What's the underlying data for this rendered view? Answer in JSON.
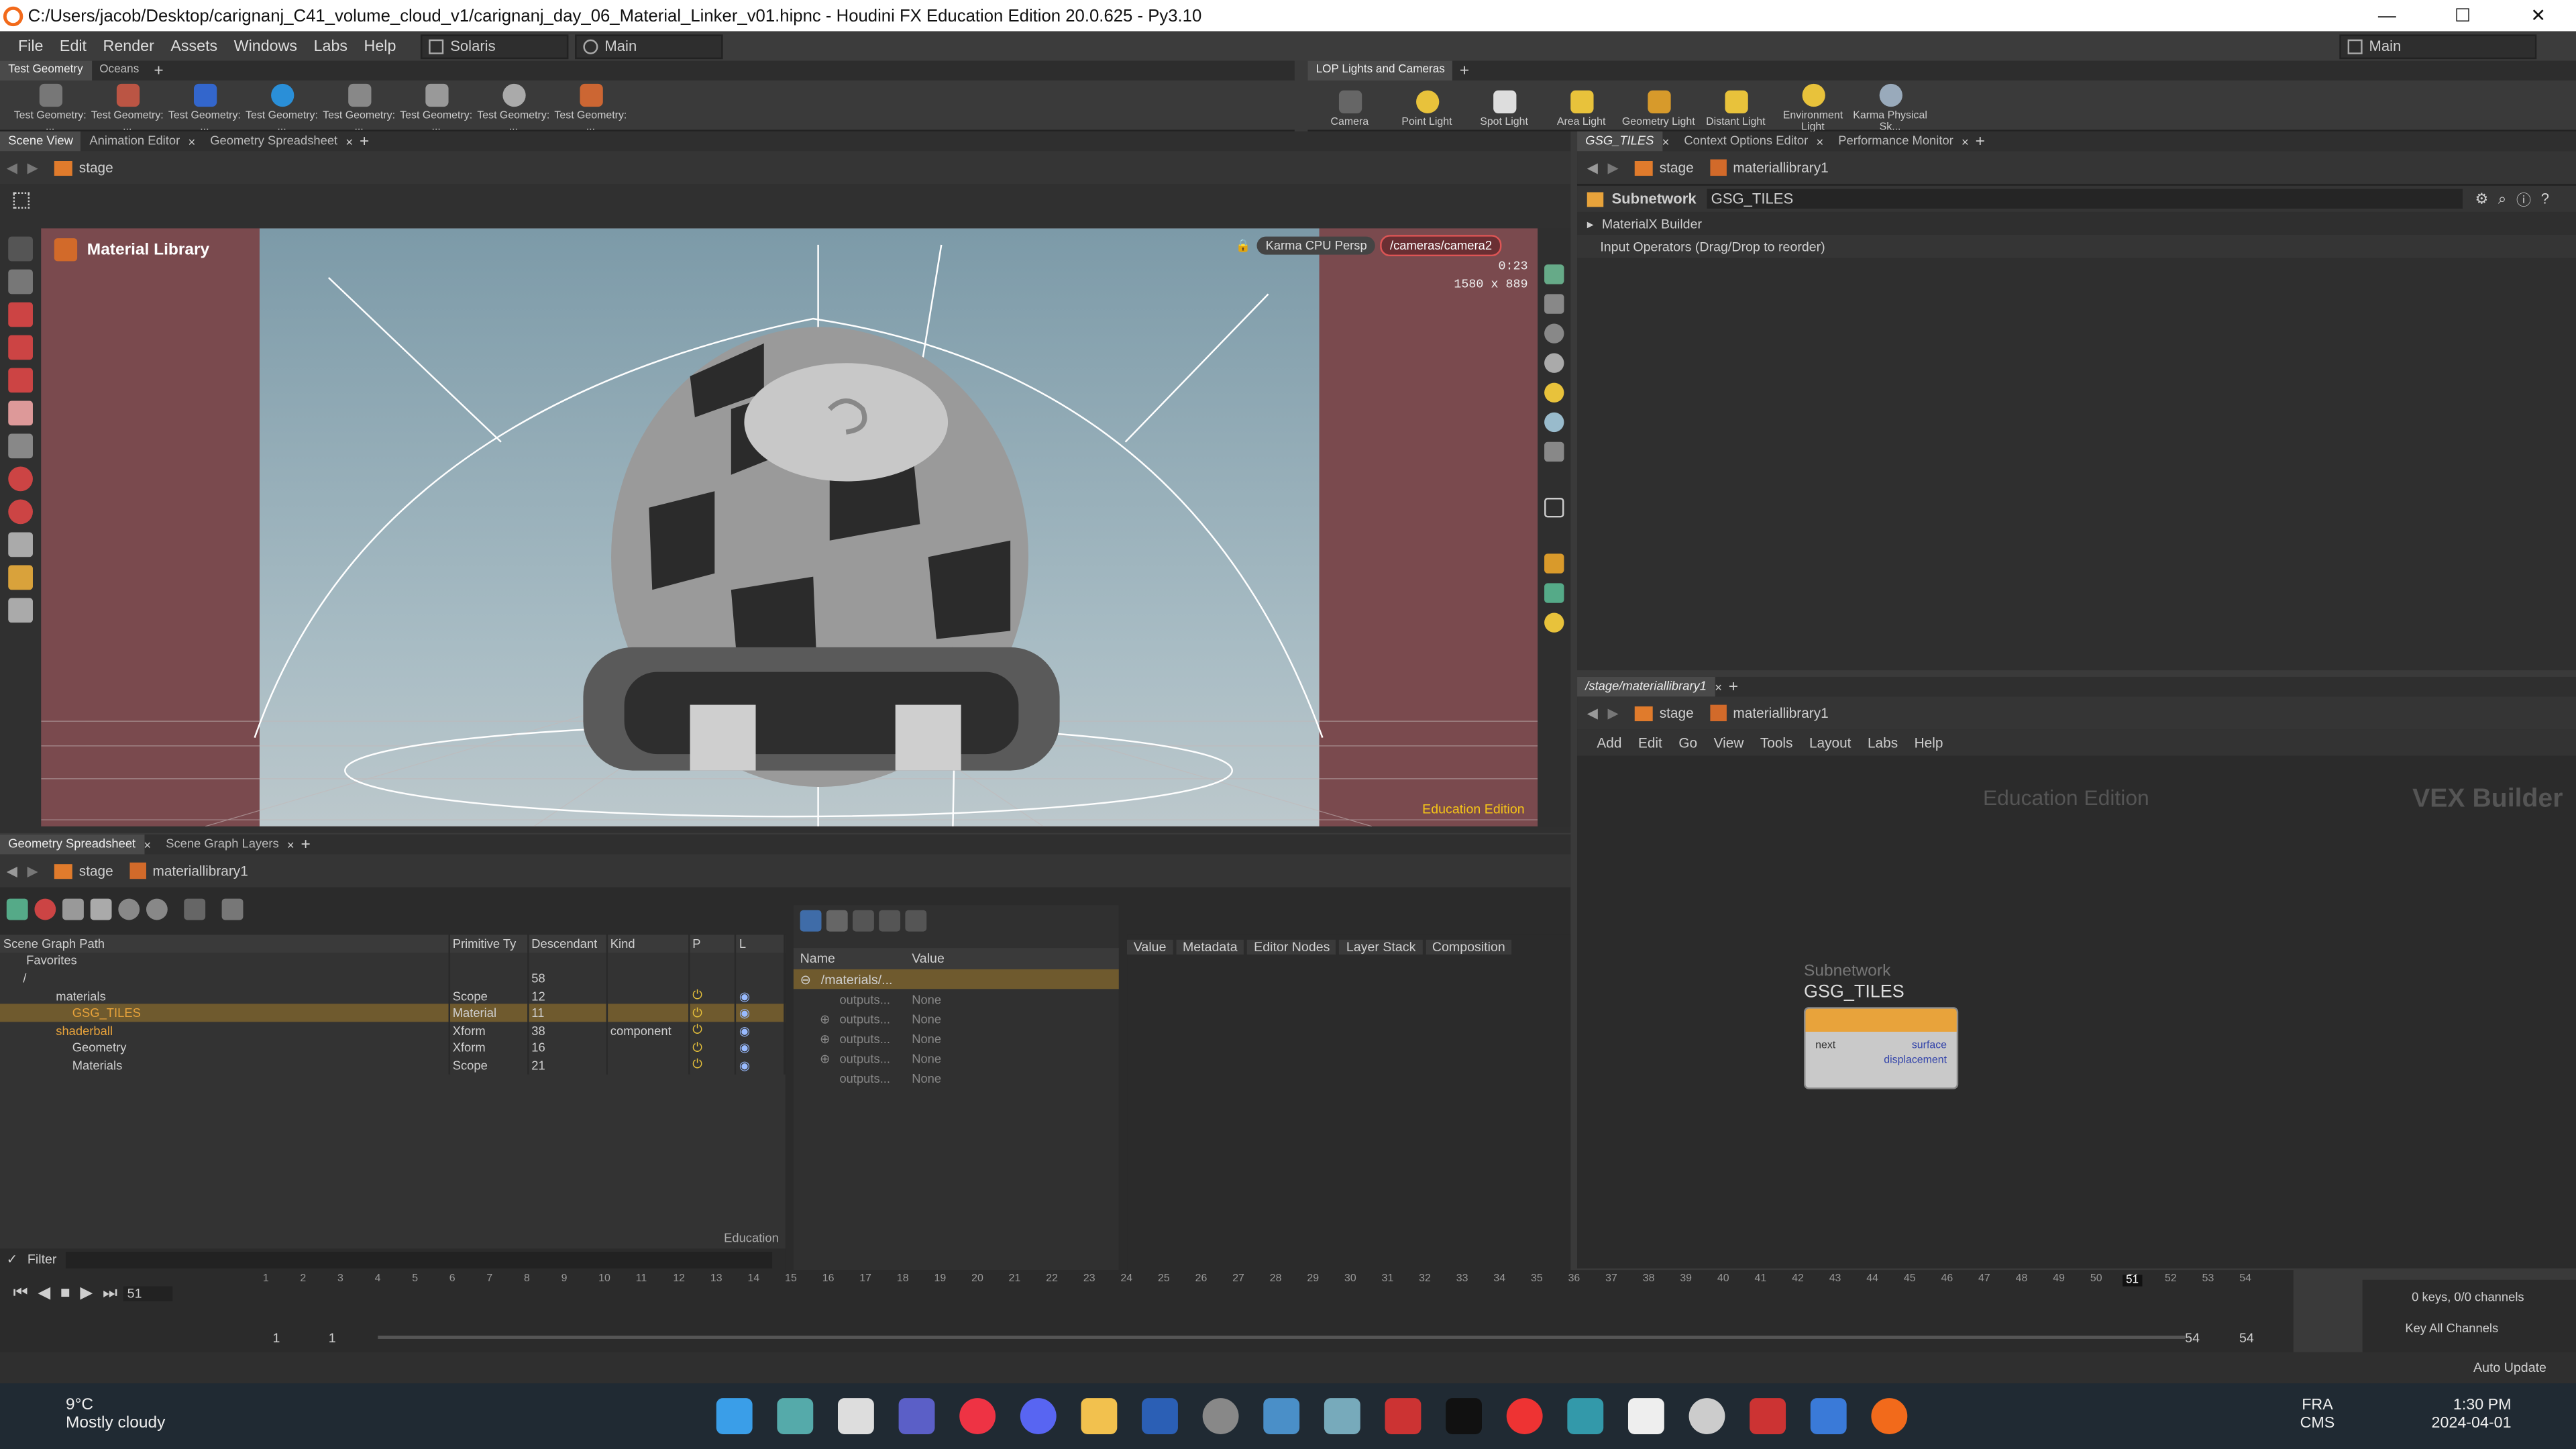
{
  "window": {
    "title": "C:/Users/jacob/Desktop/carignanj_C41_volume_cloud_v1/carignanj_day_06_Material_Linker_v01.hipnc - Houdini FX Education Edition 20.0.625 - Py3.10",
    "min": "—",
    "max": "☐",
    "close": "✕"
  },
  "menu": {
    "items": [
      "File",
      "Edit",
      "Render",
      "Assets",
      "Windows",
      "Labs",
      "Help"
    ],
    "desktop": "Solaris",
    "context": "Main",
    "right_desktop": "Main"
  },
  "shelf_left": {
    "tabs": [
      "Test Geometry",
      "Oceans"
    ],
    "tools": [
      "Test Geometry: ...",
      "Test Geometry: ...",
      "Test Geometry: ...",
      "Test Geometry: ...",
      "Test Geometry: ...",
      "Test Geometry: ...",
      "Test Geometry: ...",
      "Test Geometry: ..."
    ]
  },
  "shelf_right": {
    "tabs": [
      "LOP Lights and Cameras"
    ],
    "tools": [
      "Camera",
      "Point Light",
      "Spot Light",
      "Area Light",
      "Geometry Light",
      "Distant Light",
      "Environment Light",
      "Karma Physical Sk..."
    ]
  },
  "viewer": {
    "tabs": [
      "Scene View",
      "Animation Editor",
      "Geometry Spreadsheet"
    ],
    "path": "stage",
    "title": "Material Library",
    "renderer": "Karma CPU",
    "persp": "Persp",
    "camera": "/cameras/camera2",
    "time": "0:23",
    "resolution": "1580 x 889",
    "watermark": "Education Edition"
  },
  "params": {
    "tabs": [
      "GSG_TILES",
      "Context Options Editor",
      "Performance Monitor"
    ],
    "path_a": "stage",
    "path_b": "materiallibrary1",
    "type_label": "Subnetwork",
    "node_name": "GSG_TILES",
    "section": "MaterialX Builder",
    "inputs_label": "Input Operators (Drag/Drop to reorder)"
  },
  "network": {
    "tab": "/stage/materiallibrary1",
    "path_a": "stage",
    "path_b": "materiallibrary1",
    "menu": [
      "Add",
      "Edit",
      "Go",
      "View",
      "Tools",
      "Layout",
      "Labs",
      "Help"
    ],
    "watermark": "Education Edition",
    "context_label": "VEX Builder",
    "node_type": "Subnetwork",
    "node_name": "GSG_TILES",
    "port_in": "next",
    "port_out1": "surface",
    "port_out2": "displacement"
  },
  "scenegraph": {
    "tabs": [
      "Geometry Spreadsheet",
      "Scene Graph Layers"
    ],
    "path_a": "stage",
    "path_b": "materiallibrary1",
    "headers": [
      "Scene Graph Path",
      "Primitive Ty",
      "Descendant",
      "Kind",
      "P",
      "L"
    ],
    "rows": [
      {
        "name": "Favorites",
        "type": "",
        "desc": "",
        "kind": "",
        "indent": 1
      },
      {
        "name": "/",
        "type": "",
        "desc": "58",
        "kind": "",
        "indent": 0
      },
      {
        "name": "materials",
        "type": "Scope",
        "desc": "12",
        "kind": "",
        "indent": 1
      },
      {
        "name": "GSG_TILES",
        "type": "Material",
        "desc": "11",
        "kind": "",
        "indent": 2
      },
      {
        "name": "shaderball",
        "type": "Xform",
        "desc": "38",
        "kind": "component",
        "indent": 1
      },
      {
        "name": "Geometry",
        "type": "Xform",
        "desc": "16",
        "kind": "",
        "indent": 2
      },
      {
        "name": "Materials",
        "type": "Scope",
        "desc": "21",
        "kind": "",
        "indent": 2
      }
    ],
    "footer": "Education",
    "filter": "Filter"
  },
  "details": {
    "headers": [
      "Name",
      "Value"
    ],
    "root": "/materials/...",
    "rows": [
      {
        "name": "outputs...",
        "value": "None"
      },
      {
        "name": "outputs...",
        "value": "None"
      },
      {
        "name": "outputs...",
        "value": "None"
      },
      {
        "name": "outputs...",
        "value": "None"
      },
      {
        "name": "outputs...",
        "value": "None"
      }
    ],
    "tabs": [
      "Value",
      "Metadata",
      "Editor Nodes",
      "Layer Stack",
      "Composition"
    ]
  },
  "timeline": {
    "ticks": [
      "1",
      "2",
      "3",
      "4",
      "5",
      "6",
      "7",
      "8",
      "9",
      "10",
      "11",
      "12",
      "13",
      "14",
      "15",
      "16",
      "17",
      "18",
      "19",
      "20",
      "21",
      "22",
      "23",
      "24",
      "25",
      "26",
      "27",
      "28",
      "29",
      "30",
      "31",
      "32",
      "33",
      "34",
      "35",
      "36",
      "37",
      "38",
      "39",
      "40",
      "41",
      "42",
      "43",
      "44",
      "45",
      "46",
      "47",
      "48",
      "49",
      "50",
      "51",
      "52",
      "53",
      "54"
    ],
    "current": "51",
    "start": "1",
    "start2": "1",
    "end": "54",
    "end2": "54",
    "keys": "0 keys, 0/0 channels",
    "key_all": "Key All Channels",
    "auto": "Auto Update"
  },
  "taskbar": {
    "temp": "9°C",
    "weather": "Mostly cloudy",
    "lang1": "FRA",
    "lang2": "CMS",
    "time": "1:30 PM",
    "date": "2024-04-01"
  },
  "colors": {
    "accent": "#e8a33b",
    "selected": "#6f5a2e",
    "viewport_bg": "#7c9aa8",
    "side_bg": "#7a4a4e",
    "houdini_orange": "#f26a1b"
  }
}
